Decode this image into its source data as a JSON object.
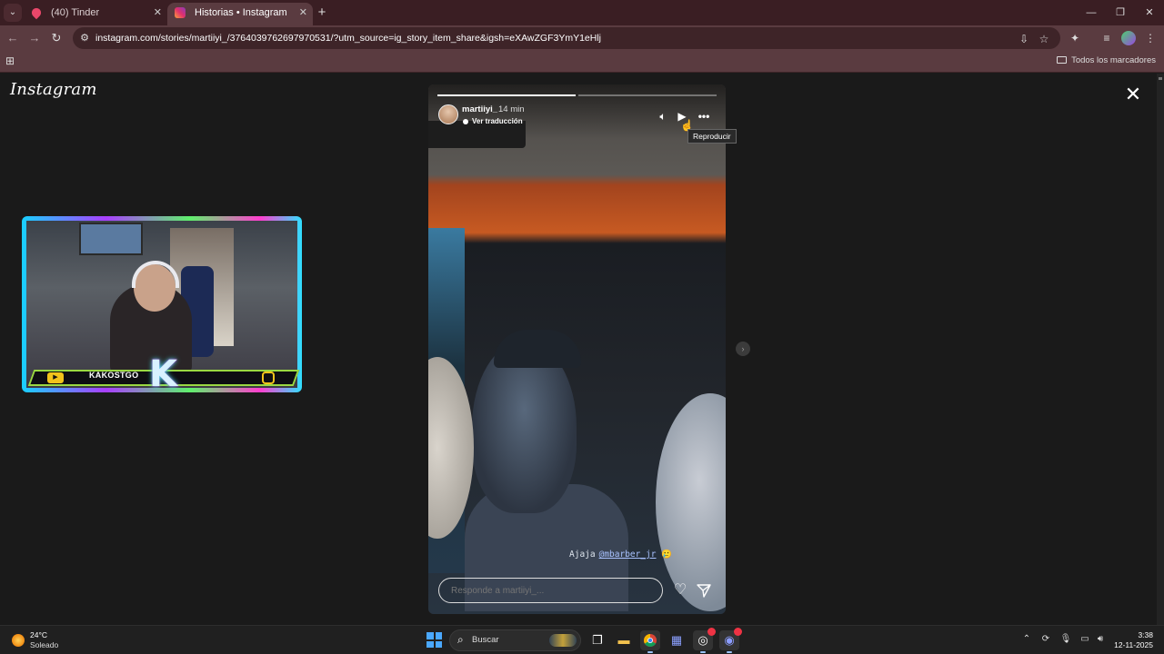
{
  "browser": {
    "tabs": [
      {
        "title": "(40) Tinder",
        "icon": "tinder-flame-icon",
        "active": false
      },
      {
        "title": "Historias • Instagram",
        "icon": "instagram-icon",
        "active": true
      }
    ],
    "url": "instagram.com/stories/martiiyi_/3764039762697970531/?utm_source=ig_story_item_share&igsh=eXAwZGF3YmY1eHlj",
    "bookmarks_label": "Todos los marcadores"
  },
  "instagram": {
    "logo": "Instagram",
    "story": {
      "username": "martiiyi_",
      "time_ago": "14 min",
      "translate_label": "Ver traducción",
      "progress": [
        1.0,
        0.0
      ],
      "caption_text": "Ajaja",
      "caption_mention": "@mbarber_jr",
      "caption_emoji": "🥲",
      "reply_placeholder": "Responde a martiiyi_...",
      "tooltip": "Reproducir"
    }
  },
  "stream_overlay": {
    "streamer_name": "KAKOSTGO",
    "logo_letter": "K"
  },
  "taskbar": {
    "weather_temp": "24°C",
    "weather_condition": "Soleado",
    "search_label": "Buscar",
    "time": "3:38",
    "date": "12-11-2025"
  },
  "colors": {
    "tabbar_bg": "#3a1e23",
    "toolbar_bg": "#5a3b40",
    "page_bg": "#1a1a1a"
  }
}
